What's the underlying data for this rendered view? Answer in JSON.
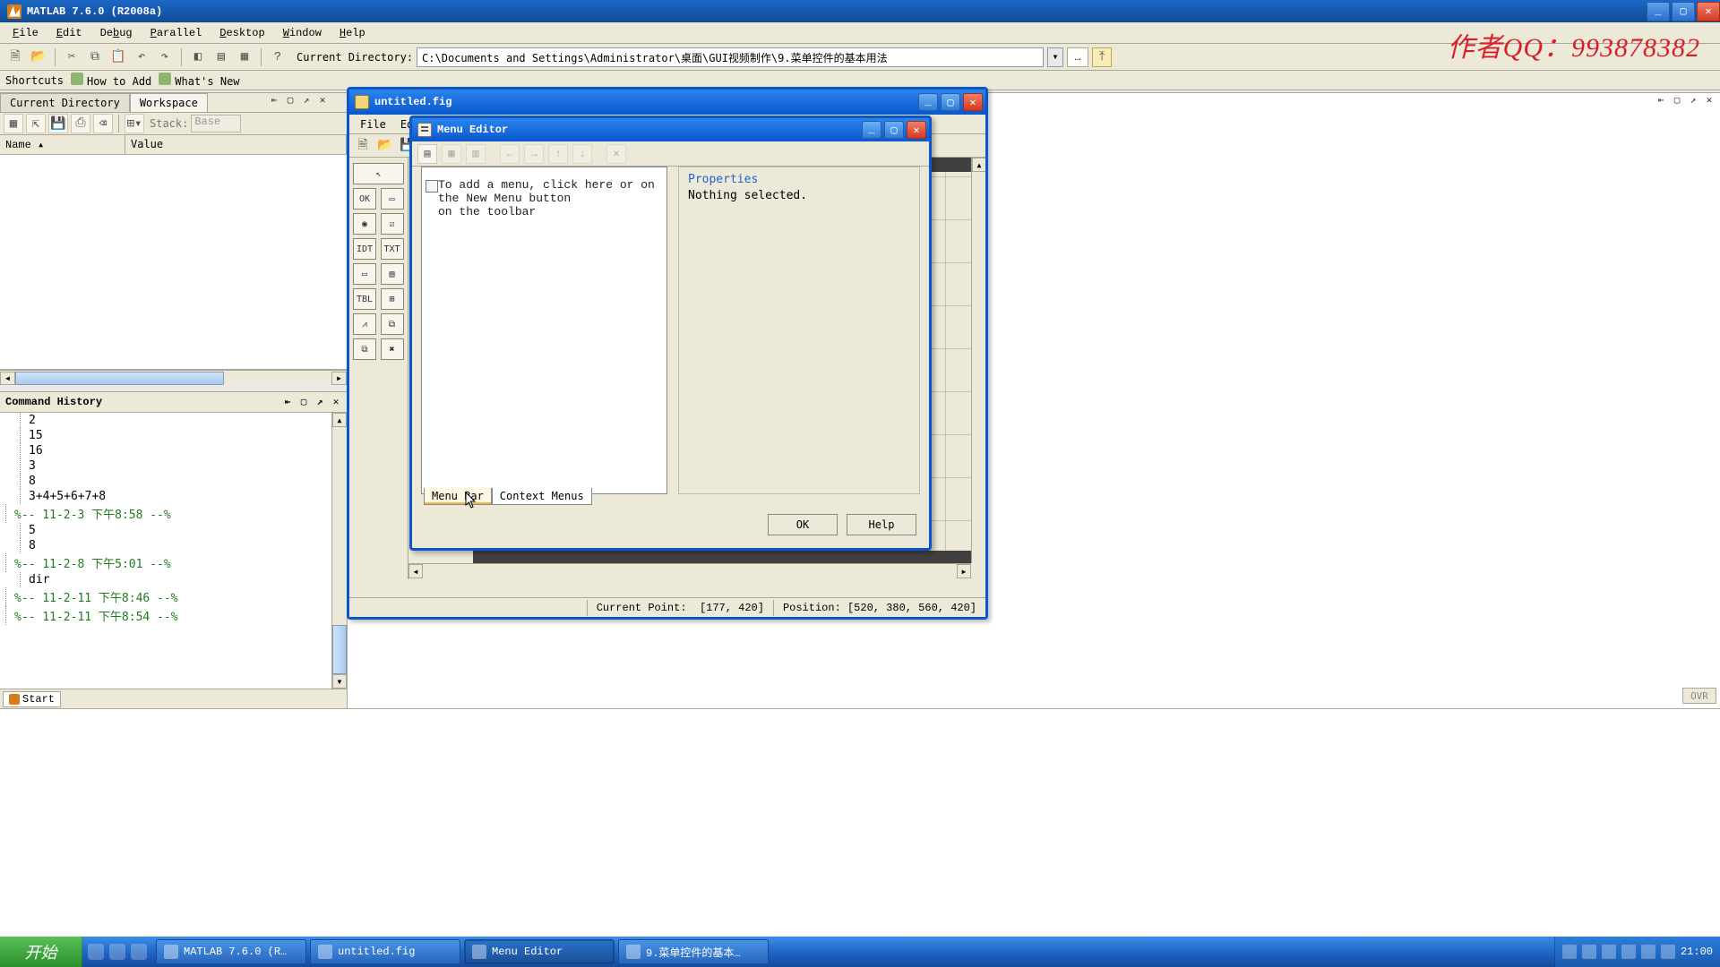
{
  "app": {
    "title": "MATLAB  7.6.0 (R2008a)",
    "menus": [
      "File",
      "Edit",
      "Debug",
      "Parallel",
      "Desktop",
      "Window",
      "Help"
    ],
    "current_dir_label": "Current Directory:",
    "current_dir_value": "C:\\Documents and Settings\\Administrator\\桌面\\GUI视频制作\\9.菜单控件的基本用法",
    "shortcuts_label": "Shortcuts",
    "shortcut1": "How to Add",
    "shortcut2": "What's New",
    "ovr": "OVR"
  },
  "watermark": "作者QQ：993878382",
  "panels": {
    "current_dir_tab": "Current Directory",
    "workspace_tab": "Workspace",
    "stack_label": "Stack:",
    "stack_value": "Base",
    "col_name": "Name",
    "col_value": "Value"
  },
  "history": {
    "title": "Command History",
    "lines": [
      {
        "t": "2",
        "g": false
      },
      {
        "t": "15",
        "g": false
      },
      {
        "t": "16",
        "g": false
      },
      {
        "t": "3",
        "g": false
      },
      {
        "t": "8",
        "g": false
      },
      {
        "t": "3+4+5+6+7+8",
        "g": false
      },
      {
        "t": "%-- 11-2-3 下午8:58 --%",
        "g": true
      },
      {
        "t": "5",
        "g": false
      },
      {
        "t": "8",
        "g": false
      },
      {
        "t": "%-- 11-2-8 下午5:01 --%",
        "g": true
      },
      {
        "t": "dir",
        "g": false
      },
      {
        "t": "%-- 11-2-11 下午8:46 --%",
        "g": true
      },
      {
        "t": "%-- 11-2-11 下午8:54 --%",
        "g": true
      }
    ]
  },
  "start_label": "Start",
  "guide": {
    "title": "untitled.fig",
    "menus": [
      "File",
      "Edi"
    ],
    "status_point_label": "Current Point:",
    "status_point_value": "[177, 420]",
    "status_pos_label": "Position:",
    "status_pos_value": "[520, 380, 560, 420]",
    "palette": [
      "↖",
      "OK",
      "▭",
      "◉",
      "☑",
      "IDT",
      "TXT",
      "▭",
      "▤",
      "TBL",
      "⊞",
      "⩘",
      "⧉",
      "⧉",
      "✖"
    ]
  },
  "menu_editor": {
    "title": "Menu Editor",
    "hint_l1": "To add a menu, click here or on",
    "hint_l2": "the New Menu button",
    "hint_l3": "on the toolbar",
    "tab_menubar": "Menu Bar",
    "tab_context": "Context Menus",
    "props_title": "Properties",
    "props_empty": "Nothing selected.",
    "btn_ok": "OK",
    "btn_help": "Help"
  },
  "taskbar": {
    "start": "开始",
    "items": [
      "MATLAB  7.6.0 (R…",
      "untitled.fig",
      "Menu Editor",
      "9.菜单控件的基本…"
    ],
    "clock": "21:00"
  }
}
